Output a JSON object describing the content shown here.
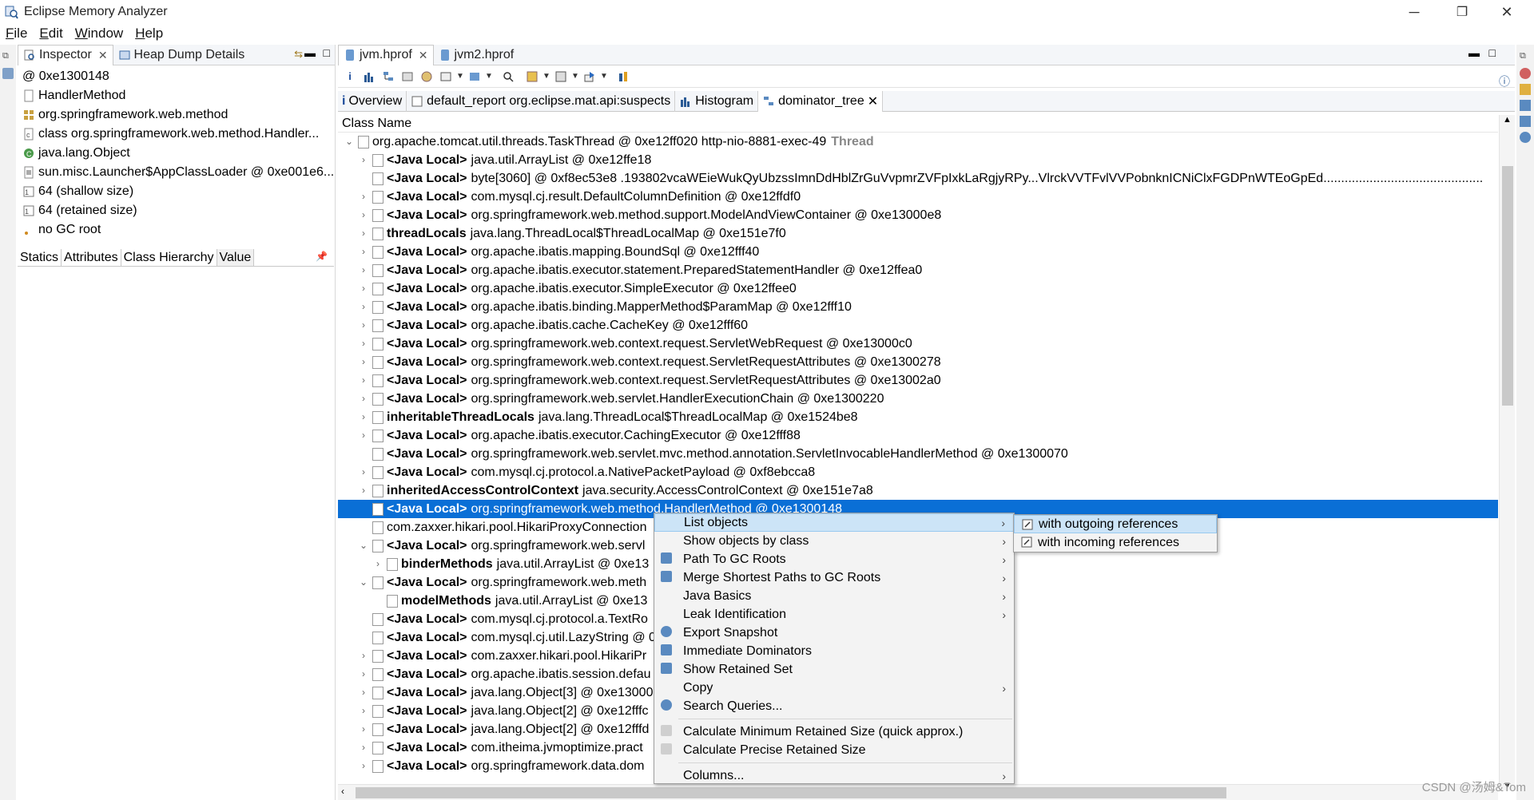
{
  "window": {
    "title": "Eclipse Memory Analyzer",
    "minimize": "─",
    "restore": "❐",
    "close": "✕"
  },
  "menubar": [
    {
      "mnemonic": "F",
      "rest": "ile"
    },
    {
      "mnemonic": "E",
      "rest": "dit"
    },
    {
      "mnemonic": "W",
      "rest": "indow"
    },
    {
      "mnemonic": "H",
      "rest": "elp"
    }
  ],
  "inspector": {
    "tabs": [
      "Inspector",
      "Heap Dump Details"
    ],
    "rows": [
      "@ 0xe1300148",
      "HandlerMethod",
      "org.springframework.web.method",
      "class org.springframework.web.method.Handler...",
      "java.lang.Object",
      "sun.misc.Launcher$AppClassLoader @ 0xe001e6...",
      "64 (shallow size)",
      "64 (retained size)",
      "no GC root"
    ],
    "bottom_tabs": [
      "Statics",
      "Attributes",
      "Class Hierarchy",
      "Value"
    ]
  },
  "editor": {
    "tabs": [
      "jvm.hprof",
      "jvm2.hprof"
    ],
    "subtabs": [
      "Overview",
      "default_report  org.eclipse.mat.api:suspects",
      "Histogram",
      "dominator_tree"
    ],
    "column_header": "Class Name",
    "rows": [
      {
        "tw": "⌄",
        "b": "",
        "t": "org.apache.tomcat.util.threads.TaskThread @ 0xe12ff020  http-nio-8881-exec-49",
        "g": "Thread",
        "ind": 0
      },
      {
        "tw": "›",
        "b": "<Java Local>",
        "t": "java.util.ArrayList @ 0xe12ffe18",
        "ind": 1
      },
      {
        "tw": "",
        "b": "<Java Local>",
        "t": "byte[3060] @ 0xf8ec53e8  .193802vcaWEieWukQyUbzssImnDdHblZrGuVvpmrZVFpIxkLaRgjyRPy...VlrckVVTFvlVVPobnknICNiClxFGDPnWTEoGpEd.............................................",
        "ind": 1
      },
      {
        "tw": "›",
        "b": "<Java Local>",
        "t": "com.mysql.cj.result.DefaultColumnDefinition @ 0xe12ffdf0",
        "ind": 1
      },
      {
        "tw": "›",
        "b": "<Java Local>",
        "t": "org.springframework.web.method.support.ModelAndViewContainer @ 0xe13000e8",
        "ind": 1
      },
      {
        "tw": "›",
        "b": "threadLocals",
        "t": "java.lang.ThreadLocal$ThreadLocalMap @ 0xe151e7f0",
        "ind": 1
      },
      {
        "tw": "›",
        "b": "<Java Local>",
        "t": "org.apache.ibatis.mapping.BoundSql @ 0xe12fff40",
        "ind": 1
      },
      {
        "tw": "›",
        "b": "<Java Local>",
        "t": "org.apache.ibatis.executor.statement.PreparedStatementHandler @ 0xe12ffea0",
        "ind": 1
      },
      {
        "tw": "›",
        "b": "<Java Local>",
        "t": "org.apache.ibatis.executor.SimpleExecutor @ 0xe12ffee0",
        "ind": 1
      },
      {
        "tw": "›",
        "b": "<Java Local>",
        "t": "org.apache.ibatis.binding.MapperMethod$ParamMap @ 0xe12fff10",
        "ind": 1
      },
      {
        "tw": "›",
        "b": "<Java Local>",
        "t": "org.apache.ibatis.cache.CacheKey @ 0xe12fff60",
        "ind": 1
      },
      {
        "tw": "›",
        "b": "<Java Local>",
        "t": "org.springframework.web.context.request.ServletWebRequest @ 0xe13000c0",
        "ind": 1
      },
      {
        "tw": "›",
        "b": "<Java Local>",
        "t": "org.springframework.web.context.request.ServletRequestAttributes @ 0xe1300278",
        "ind": 1
      },
      {
        "tw": "›",
        "b": "<Java Local>",
        "t": "org.springframework.web.context.request.ServletRequestAttributes @ 0xe13002a0",
        "ind": 1
      },
      {
        "tw": "›",
        "b": "<Java Local>",
        "t": "org.springframework.web.servlet.HandlerExecutionChain @ 0xe1300220",
        "ind": 1
      },
      {
        "tw": "›",
        "b": "inheritableThreadLocals",
        "t": "java.lang.ThreadLocal$ThreadLocalMap @ 0xe1524be8",
        "ind": 1
      },
      {
        "tw": "›",
        "b": "<Java Local>",
        "t": "org.apache.ibatis.executor.CachingExecutor @ 0xe12fff88",
        "ind": 1
      },
      {
        "tw": "",
        "b": "<Java Local>",
        "t": "org.springframework.web.servlet.mvc.method.annotation.ServletInvocableHandlerMethod @ 0xe1300070",
        "ind": 1
      },
      {
        "tw": "›",
        "b": "<Java Local>",
        "t": "com.mysql.cj.protocol.a.NativePacketPayload @ 0xf8ebcca8",
        "ind": 1
      },
      {
        "tw": "›",
        "b": "inheritedAccessControlContext",
        "t": "java.security.AccessControlContext @ 0xe151e7a8",
        "ind": 1
      },
      {
        "tw": "",
        "b": "<Java Local>",
        "t": "org.springframework.web.method.HandlerMethod @ 0xe1300148",
        "ind": 1,
        "sel": true
      },
      {
        "tw": "",
        "b": "",
        "t": "com.zaxxer.hikari.pool.HikariProxyConnection",
        "ind": 1
      },
      {
        "tw": "⌄",
        "b": "<Java Local>",
        "t": "org.springframework.web.servl",
        "ind": 1
      },
      {
        "tw": "›",
        "b": "binderMethods",
        "t": "java.util.ArrayList @ 0xe13",
        "ind": 2
      },
      {
        "tw": "⌄",
        "b": "<Java Local>",
        "t": "org.springframework.web.meth",
        "ind": 1
      },
      {
        "tw": "",
        "b": "modelMethods",
        "t": "java.util.ArrayList @ 0xe13",
        "ind": 2
      },
      {
        "tw": "",
        "b": "<Java Local>",
        "t": "com.mysql.cj.protocol.a.TextRo",
        "ind": 1
      },
      {
        "tw": "",
        "b": "<Java Local>",
        "t": "com.mysql.cj.util.LazyString @ 0",
        "ind": 1
      },
      {
        "tw": "›",
        "b": "<Java Local>",
        "t": "com.zaxxer.hikari.pool.HikariPr",
        "ind": 1
      },
      {
        "tw": "›",
        "b": "<Java Local>",
        "t": "org.apache.ibatis.session.defau",
        "ind": 1
      },
      {
        "tw": "›",
        "b": "<Java Local>",
        "t": "java.lang.Object[3] @ 0xe13000",
        "ind": 1
      },
      {
        "tw": "›",
        "b": "<Java Local>",
        "t": "java.lang.Object[2] @ 0xe12fffc",
        "ind": 1
      },
      {
        "tw": "›",
        "b": "<Java Local>",
        "t": "java.lang.Object[2] @ 0xe12fffd",
        "ind": 1
      },
      {
        "tw": "›",
        "b": "<Java Local>",
        "t": "com.itheima.jvmoptimize.pract",
        "ind": 1
      },
      {
        "tw": "›",
        "b": "<Java Local>",
        "t": "org.springframework.data.dom",
        "ind": 1
      }
    ]
  },
  "context_menu": {
    "items": [
      {
        "label": "List objects",
        "arrow": true,
        "hl": true,
        "icon": ""
      },
      {
        "label": "Show objects by class",
        "arrow": true,
        "icon": ""
      },
      {
        "label": "Path To GC Roots",
        "arrow": true,
        "icon": "path-gc-icon"
      },
      {
        "label": "Merge Shortest Paths to GC Roots",
        "arrow": true,
        "icon": "merge-paths-icon"
      },
      {
        "label": "Java Basics",
        "arrow": true,
        "icon": ""
      },
      {
        "label": "Leak Identification",
        "arrow": true,
        "icon": ""
      },
      {
        "label": "Export Snapshot",
        "arrow": false,
        "icon": "export-icon"
      },
      {
        "label": "Immediate Dominators",
        "arrow": false,
        "icon": "dominators-icon"
      },
      {
        "label": "Show Retained Set",
        "arrow": false,
        "icon": "retained-set-icon"
      },
      {
        "label": "Copy",
        "arrow": true,
        "icon": ""
      },
      {
        "label": "Search Queries...",
        "arrow": false,
        "icon": "search-queries-icon",
        "sep_after": true
      },
      {
        "label": "Calculate Minimum Retained Size (quick approx.)",
        "arrow": false,
        "icon": "calc-icon"
      },
      {
        "label": "Calculate Precise Retained Size",
        "arrow": false,
        "icon": "calc-icon",
        "sep_after": true
      },
      {
        "label": "Columns...",
        "arrow": true,
        "icon": ""
      }
    ]
  },
  "submenu": {
    "items": [
      "with outgoing references",
      "with incoming references"
    ]
  },
  "watermark": "CSDN @汤姆&Tom"
}
